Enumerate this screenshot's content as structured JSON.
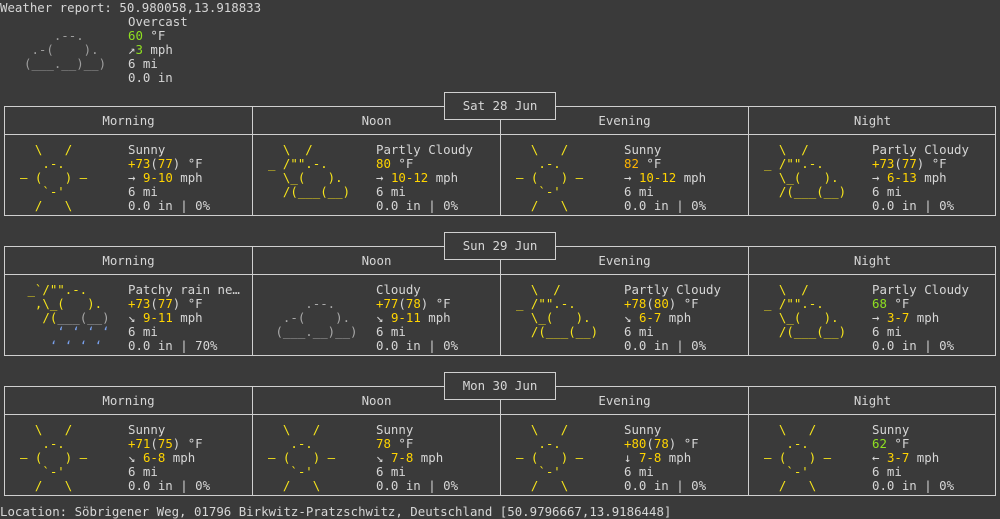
{
  "header": {
    "title": "Weather report: 50.980058,13.918833"
  },
  "current": {
    "icon": "cloud-icon",
    "condition": "Overcast",
    "temp_value": "60",
    "temp_unit": " °F",
    "wind_arrow": "↗",
    "wind_value": "3",
    "wind_unit": " mph",
    "visibility": "6 mi",
    "precip": "0.0 in"
  },
  "period_labels": [
    "Morning",
    "Noon",
    "Evening",
    "Night"
  ],
  "days": [
    {
      "date": "Sat 28 Jun",
      "periods": [
        {
          "icon": "sun-icon",
          "condition": "Sunny",
          "temp_main": "+73",
          "temp_paren": "77",
          "temp_unit": " °F",
          "wind_arrow": "→",
          "wind_range": "9-10",
          "wind_unit": " mph",
          "visibility": "6 mi",
          "precip": "0.0 in | 0%"
        },
        {
          "icon": "partly-cloudy-icon",
          "condition": "Partly Cloudy",
          "temp_main": "80",
          "temp_paren": "",
          "temp_unit": " °F",
          "wind_arrow": "→",
          "wind_range": "10-12",
          "wind_unit": " mph",
          "visibility": "6 mi",
          "precip": "0.0 in | 0%"
        },
        {
          "icon": "sun-icon",
          "condition": "Sunny",
          "temp_main": "82",
          "temp_paren": "",
          "temp_unit": " °F",
          "wind_arrow": "→",
          "wind_range": "10-12",
          "wind_unit": " mph",
          "visibility": "6 mi",
          "precip": "0.0 in | 0%"
        },
        {
          "icon": "partly-cloudy-icon",
          "condition": "Partly Cloudy",
          "temp_main": "+73",
          "temp_paren": "77",
          "temp_unit": " °F",
          "wind_arrow": "→",
          "wind_range": "6-13",
          "wind_unit": " mph",
          "visibility": "6 mi",
          "precip": "0.0 in | 0%"
        }
      ]
    },
    {
      "date": "Sun 29 Jun",
      "periods": [
        {
          "icon": "rain-icon",
          "condition": "Patchy rain ne…",
          "temp_main": "+73",
          "temp_paren": "77",
          "temp_unit": " °F",
          "wind_arrow": "↘",
          "wind_range": "9-11",
          "wind_unit": " mph",
          "visibility": "6 mi",
          "precip": "0.0 in | 70%"
        },
        {
          "icon": "cloud-icon",
          "condition": "Cloudy",
          "temp_main": "+77",
          "temp_paren": "78",
          "temp_unit": " °F",
          "wind_arrow": "↘",
          "wind_range": "9-11",
          "wind_unit": " mph",
          "visibility": "6 mi",
          "precip": "0.0 in | 0%"
        },
        {
          "icon": "partly-cloudy-icon",
          "condition": "Partly Cloudy",
          "temp_main": "+78",
          "temp_paren": "80",
          "temp_unit": " °F",
          "wind_arrow": "↘",
          "wind_range": "6-7",
          "wind_unit": " mph",
          "visibility": "6 mi",
          "precip": "0.0 in | 0%"
        },
        {
          "icon": "partly-cloudy-icon",
          "condition": "Partly Cloudy",
          "temp_main": "68",
          "temp_paren": "",
          "temp_unit": " °F",
          "wind_arrow": "→",
          "wind_range": "3-7",
          "wind_unit": " mph",
          "visibility": "6 mi",
          "precip": "0.0 in | 0%"
        }
      ]
    },
    {
      "date": "Mon 30 Jun",
      "periods": [
        {
          "icon": "sun-icon",
          "condition": "Sunny",
          "temp_main": "+71",
          "temp_paren": "75",
          "temp_unit": " °F",
          "wind_arrow": "↘",
          "wind_range": "6-8",
          "wind_unit": " mph",
          "visibility": "6 mi",
          "precip": "0.0 in | 0%"
        },
        {
          "icon": "sun-icon",
          "condition": "Sunny",
          "temp_main": "78",
          "temp_paren": "",
          "temp_unit": " °F",
          "wind_arrow": "↘",
          "wind_range": "7-8",
          "wind_unit": " mph",
          "visibility": "6 mi",
          "precip": "0.0 in | 0%"
        },
        {
          "icon": "sun-icon",
          "condition": "Sunny",
          "temp_main": "+80",
          "temp_paren": "78",
          "temp_unit": " °F",
          "wind_arrow": "↓",
          "wind_range": "7-8",
          "wind_unit": " mph",
          "visibility": "6 mi",
          "precip": "0.0 in | 0%"
        },
        {
          "icon": "sun-icon",
          "condition": "Sunny",
          "temp_main": "62",
          "temp_paren": "",
          "temp_unit": " °F",
          "wind_arrow": "←",
          "wind_range": "3-7",
          "wind_unit": " mph",
          "visibility": "6 mi",
          "precip": "0.0 in | 0%"
        }
      ]
    }
  ],
  "footer": {
    "location": "Location: Söbrigener Weg, 01796 Birkwitz-Pratzschwitz, Deutschland [50.9796667,13.9186448]"
  }
}
